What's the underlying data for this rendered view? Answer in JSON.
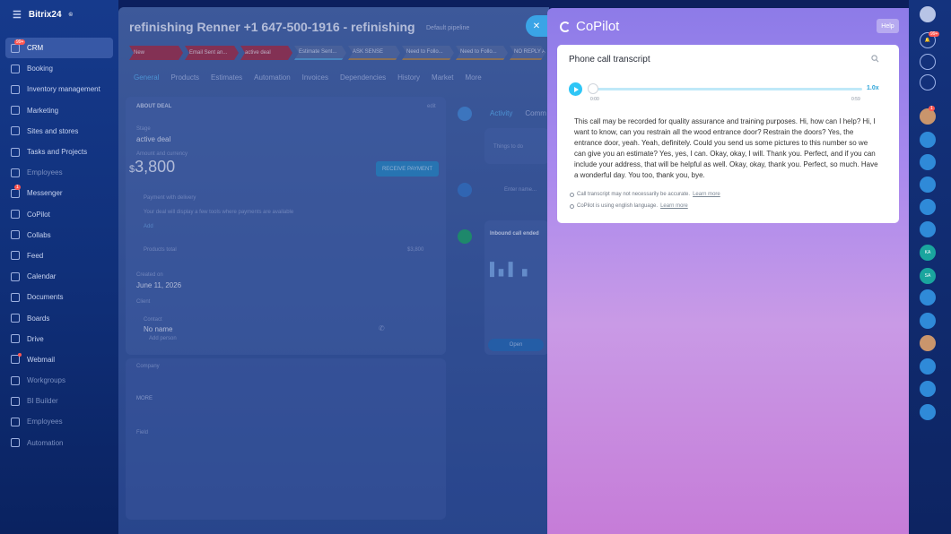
{
  "app": {
    "name": "Bitrix24",
    "mark": "©"
  },
  "sidebar": {
    "items": [
      {
        "label": "CRM",
        "badge": "99+"
      },
      {
        "label": "Booking"
      },
      {
        "label": "Inventory management"
      },
      {
        "label": "Marketing"
      },
      {
        "label": "Sites and stores"
      },
      {
        "label": "Tasks and Projects"
      },
      {
        "label": "Employees"
      },
      {
        "label": "Messenger",
        "badge": "1"
      },
      {
        "label": "CoPilot"
      },
      {
        "label": "Collabs"
      },
      {
        "label": "Feed"
      },
      {
        "label": "Calendar"
      },
      {
        "label": "Documents"
      },
      {
        "label": "Boards"
      },
      {
        "label": "Drive"
      },
      {
        "label": "Webmail"
      },
      {
        "label": "Workgroups"
      },
      {
        "label": "BI Builder"
      },
      {
        "label": "Employees"
      },
      {
        "label": "Automation"
      }
    ]
  },
  "deal": {
    "title": "refinishing Renner +1 647-500-1916 - refinishing",
    "pipeline": "Default pipeline",
    "stages": [
      "New",
      "Email Sent an...",
      "active deal",
      "Estimate Sent...",
      "ASK SENSE",
      "Need to Follo...",
      "Need to Follo...",
      "NO REPLY A"
    ],
    "tabs": [
      "General",
      "Products",
      "Estimates",
      "Automation",
      "Invoices",
      "Dependencies",
      "History",
      "Market",
      "More"
    ],
    "about_label": "ABOUT DEAL",
    "edit_label": "edit",
    "stage_label": "Stage",
    "stage_value": "active deal",
    "amount_label": "Amount and currency",
    "currency": "$",
    "amount": "3,800",
    "receive_payment": "RECEIVE PAYMENT",
    "payment_note": "Payment with delivery",
    "payment_desc": "Your deal will display a few tools where payments are available",
    "add": "Add",
    "products_label": "Products total",
    "products_value": "$3,800",
    "created_label": "Created on",
    "created_value": "June 11, 2026",
    "client_label": "Client",
    "contact_label": "Contact",
    "contact_name": "No name",
    "contact_sub": "Add person",
    "company_label": "Company",
    "more_label": "MORE",
    "fields_label": "Field"
  },
  "activity": {
    "tabs": [
      "Activity",
      "Comm"
    ],
    "placeholder": "Things to do",
    "search_hint": "Enter name...",
    "call_label": "Inbound call ended",
    "open_label": "Open"
  },
  "copilot": {
    "title": "CoPilot",
    "help": "Help",
    "card_title": "Phone call transcript",
    "time_start": "0:00",
    "time_end": "0:59",
    "speed": "1.0x",
    "progress": 0,
    "transcript": "This call may be recorded for quality assurance and training purposes. Hi, how can I help? Hi, I want to know, can you restrain all the wood entrance door? Restrain the doors? Yes, the entrance door, yeah. Yeah, definitely. Could you send us some pictures to this number so we can give you an estimate? Yes, yes, I can. Okay, okay, I will. Thank you. Perfect, and if you can include your address, that will be helpful as well. Okay, okay, thank you. Perfect, so much. Have a wonderful day. You too, thank you, bye.",
    "note1": "Call transcript may not necessarily be accurate.",
    "note2": "CoPilot is using english language.",
    "learn_more": "Learn more"
  },
  "rail": {
    "notifications_badge": "99+",
    "avatar_badge": "1",
    "initials1": "KA",
    "initials2": "SA"
  },
  "colors": {
    "accent": "#2fc6f6",
    "brand": "#163a8c",
    "stage_red": "#a8344b"
  }
}
